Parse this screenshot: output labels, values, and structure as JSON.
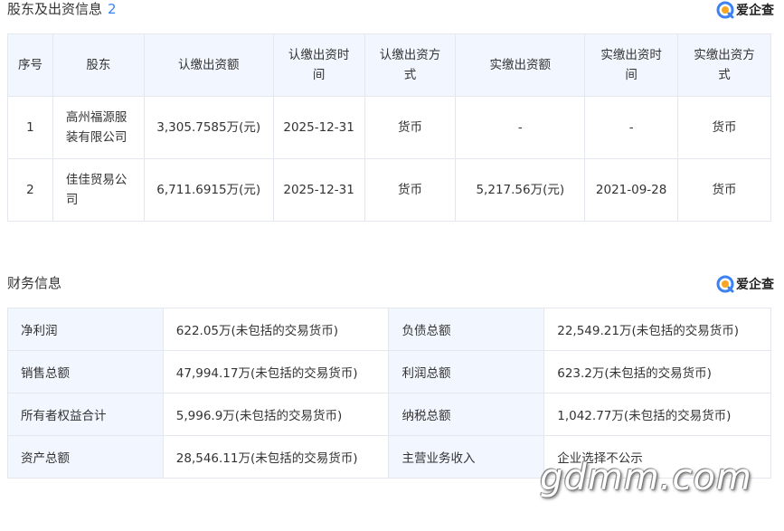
{
  "shareholders_section": {
    "title": "股东及出资信息",
    "count": "2",
    "brand": "爱企查",
    "headers": {
      "index": "序号",
      "shareholder": "股东",
      "subscribed_amount": "认缴出资额",
      "subscribed_time": "认缴出资时间",
      "subscribed_method": "认缴出资方式",
      "paid_amount": "实缴出资额",
      "paid_time": "实缴出资时间",
      "paid_method": "实缴出资方式"
    },
    "rows": [
      {
        "index": "1",
        "name": "高州福源服装有限公司",
        "subscribed_amount": "3,305.7585万(元)",
        "subscribed_time": "2025-12-31",
        "subscribed_method": "货币",
        "paid_amount": "-",
        "paid_time": "-",
        "paid_method": "货币"
      },
      {
        "index": "2",
        "name": "佳佳贸易公司",
        "subscribed_amount": "6,711.6915万(元)",
        "subscribed_time": "2025-12-31",
        "subscribed_method": "货币",
        "paid_amount": "5,217.56万(元)",
        "paid_time": "2021-09-28",
        "paid_method": "货币"
      }
    ]
  },
  "finance_section": {
    "title": "财务信息",
    "brand": "爱企查",
    "rows": [
      {
        "label1": "净利润",
        "value1": "622.05万(未包括的交易货币)",
        "label2": "负债总额",
        "value2": "22,549.21万(未包括的交易货币)"
      },
      {
        "label1": "销售总额",
        "value1": "47,994.17万(未包括的交易货币)",
        "label2": "利润总额",
        "value2": "623.2万(未包括的交易货币)"
      },
      {
        "label1": "所有者权益合计",
        "value1": "5,996.9万(未包括的交易货币)",
        "label2": "纳税总额",
        "value2": "1,042.77万(未包括的交易货币)"
      },
      {
        "label1": "资产总额",
        "value1": "28,546.11万(未包括的交易货币)",
        "label2": "主营业务收入",
        "value2": "企业选择不公示"
      }
    ]
  },
  "watermark": "gdmm.com",
  "colors": {
    "accent": "#3c82f2",
    "header_bg": "#f2f7ff",
    "border": "#e4e8ee",
    "brand_orange": "#f5a623"
  }
}
